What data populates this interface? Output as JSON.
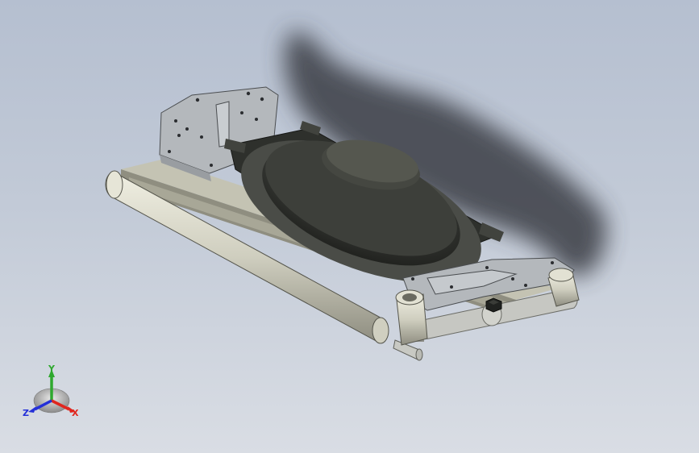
{
  "viewport": {
    "background_top": "#b5bfd0",
    "background_bottom": "#d9dde4"
  },
  "model": {
    "base_plate_color": "#c4c3b3",
    "bracket_color": "#b4b8bc",
    "pad_color": "#353733",
    "roller_color": "#d8d8c8",
    "shaft_color": "#c6c7c2",
    "shadow_color": "#3a3d44"
  },
  "triad": {
    "x_label": "X",
    "y_label": "Y",
    "z_label": "Z",
    "x_color": "#e0261e",
    "y_color": "#2ea82e",
    "z_color": "#2430d8"
  }
}
